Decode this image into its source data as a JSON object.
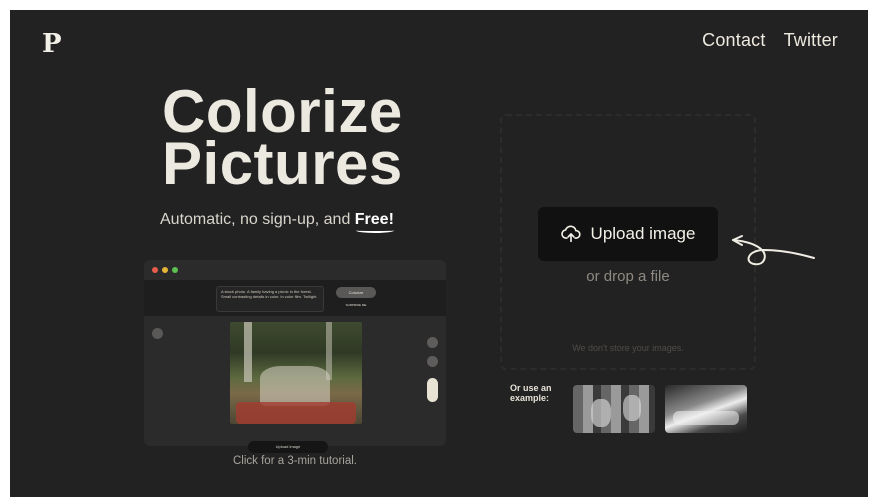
{
  "header": {
    "logo": "P",
    "nav": [
      {
        "label": "Contact"
      },
      {
        "label": "Twitter"
      }
    ]
  },
  "hero": {
    "title_line1": "Colorize",
    "title_line2": "Pictures",
    "subtitle_prefix": "Automatic, no sign-up, and ",
    "subtitle_free": "Free!"
  },
  "preview": {
    "prompt_text": "A stock photo. A family having a picnic in the forest. Small contrasting details in color. In color film. Twilight.",
    "colorize_label": "Colorize",
    "surprise_label": "SURPRISE ME",
    "upload_label": "Upload image",
    "tutorial_text": "Click for a 3-min tutorial."
  },
  "upload": {
    "button_label": "Upload image",
    "drop_text": "or drop a file",
    "privacy_text": "We don't store your images."
  },
  "examples": {
    "label": "Or use an example:"
  },
  "colors": {
    "background": "#232222",
    "button_bg": "#111111",
    "text_light": "#eceae0",
    "dot_red": "#e85c4a",
    "dot_yellow": "#e5b53a",
    "dot_green": "#5cc052"
  }
}
